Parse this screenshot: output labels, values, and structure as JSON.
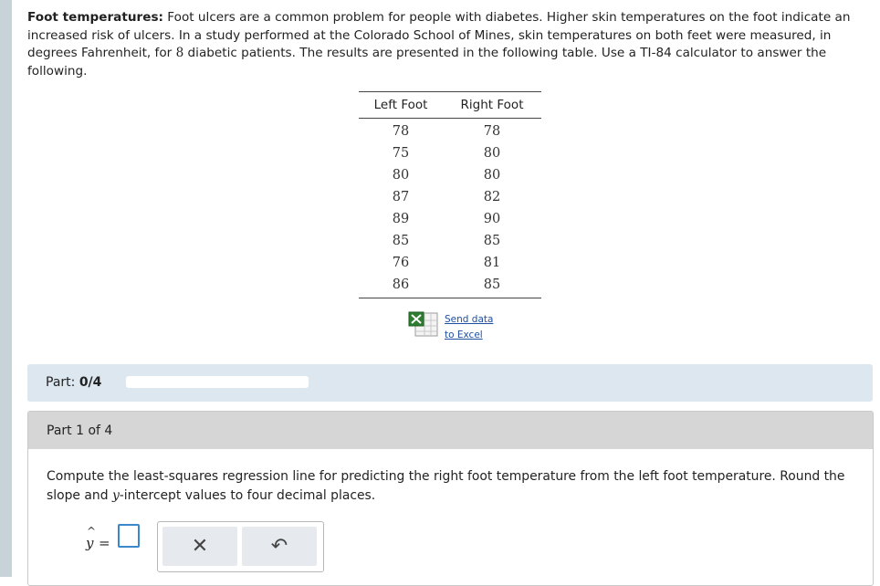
{
  "problem": {
    "lead": "Foot temperatures:",
    "text_1": " Foot ulcers are a common problem for people with diabetes. Higher skin temperatures on the foot indicate an increased risk of ulcers. In a study performed at the Colorado School of Mines, skin temperatures on both feet were measured, in degrees Fahrenheit, for ",
    "n": "8",
    "text_2": " diabetic patients. The results are presented in the following table. Use a TI-84 calculator to answer the following."
  },
  "table": {
    "headers": [
      "Left Foot",
      "Right Foot"
    ],
    "rows": [
      [
        "78",
        "78"
      ],
      [
        "75",
        "80"
      ],
      [
        "80",
        "80"
      ],
      [
        "87",
        "82"
      ],
      [
        "89",
        "90"
      ],
      [
        "85",
        "85"
      ],
      [
        "76",
        "81"
      ],
      [
        "86",
        "85"
      ]
    ]
  },
  "excel": {
    "line1": "Send data",
    "line2": "to Excel",
    "icon": "excel-icon"
  },
  "progress": {
    "label": "Part: ",
    "value": "0/4",
    "fraction": 0
  },
  "part": {
    "header": "Part 1 of 4",
    "question_1": "Compute the least-squares regression line for predicting the right foot temperature from the left foot temperature. Round the slope and ",
    "question_var": "y",
    "question_2": "-intercept values to four decimal places."
  },
  "answer": {
    "hat": "^",
    "var": "y",
    "equals": "=",
    "clear_symbol": "✕",
    "undo_symbol": "↶",
    "icons": [
      "clear-icon",
      "undo-icon"
    ]
  }
}
